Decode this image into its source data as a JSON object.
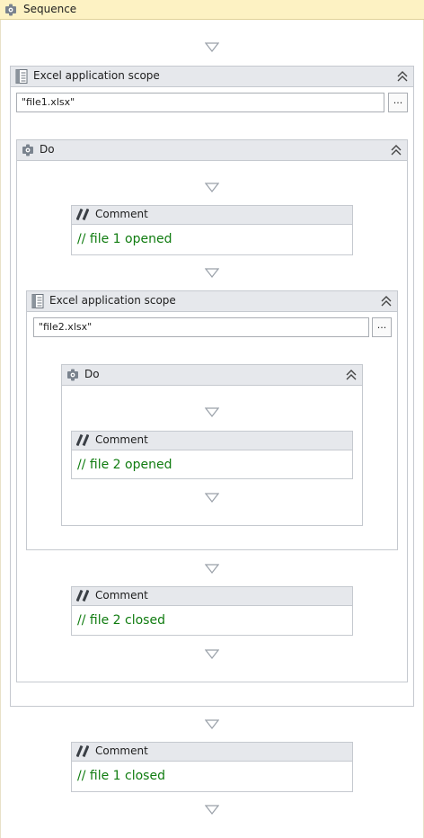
{
  "sequence": {
    "title": "Sequence"
  },
  "excel_scope_1": {
    "title": "Excel application scope",
    "path_value": "\"file1.xlsx\"",
    "browse_label": "...",
    "do_title": "Do"
  },
  "comment_file1_opened": {
    "title": "Comment",
    "text": "// file 1 opened"
  },
  "excel_scope_2": {
    "title": "Excel application scope",
    "path_value": "\"file2.xlsx\"",
    "browse_label": "...",
    "do_title": "Do"
  },
  "comment_file2_opened": {
    "title": "Comment",
    "text": "// file 2 opened"
  },
  "comment_file2_closed": {
    "title": "Comment",
    "text": "// file 2 closed"
  },
  "comment_file1_closed": {
    "title": "Comment",
    "text": "// file 1 closed"
  },
  "icons": {
    "sequence": "sequence-icon",
    "excel_scope": "excel-scope-icon",
    "do": "do-icon",
    "comment": "comment-icon",
    "collapse": "collapse-icon",
    "drop_arrow": "drop-arrow-icon"
  },
  "colors": {
    "sequence_header": "#fdf2c3",
    "panel_header": "#e6e8ec",
    "panel_border": "#c5c9cf",
    "comment_text": "#107c10"
  }
}
